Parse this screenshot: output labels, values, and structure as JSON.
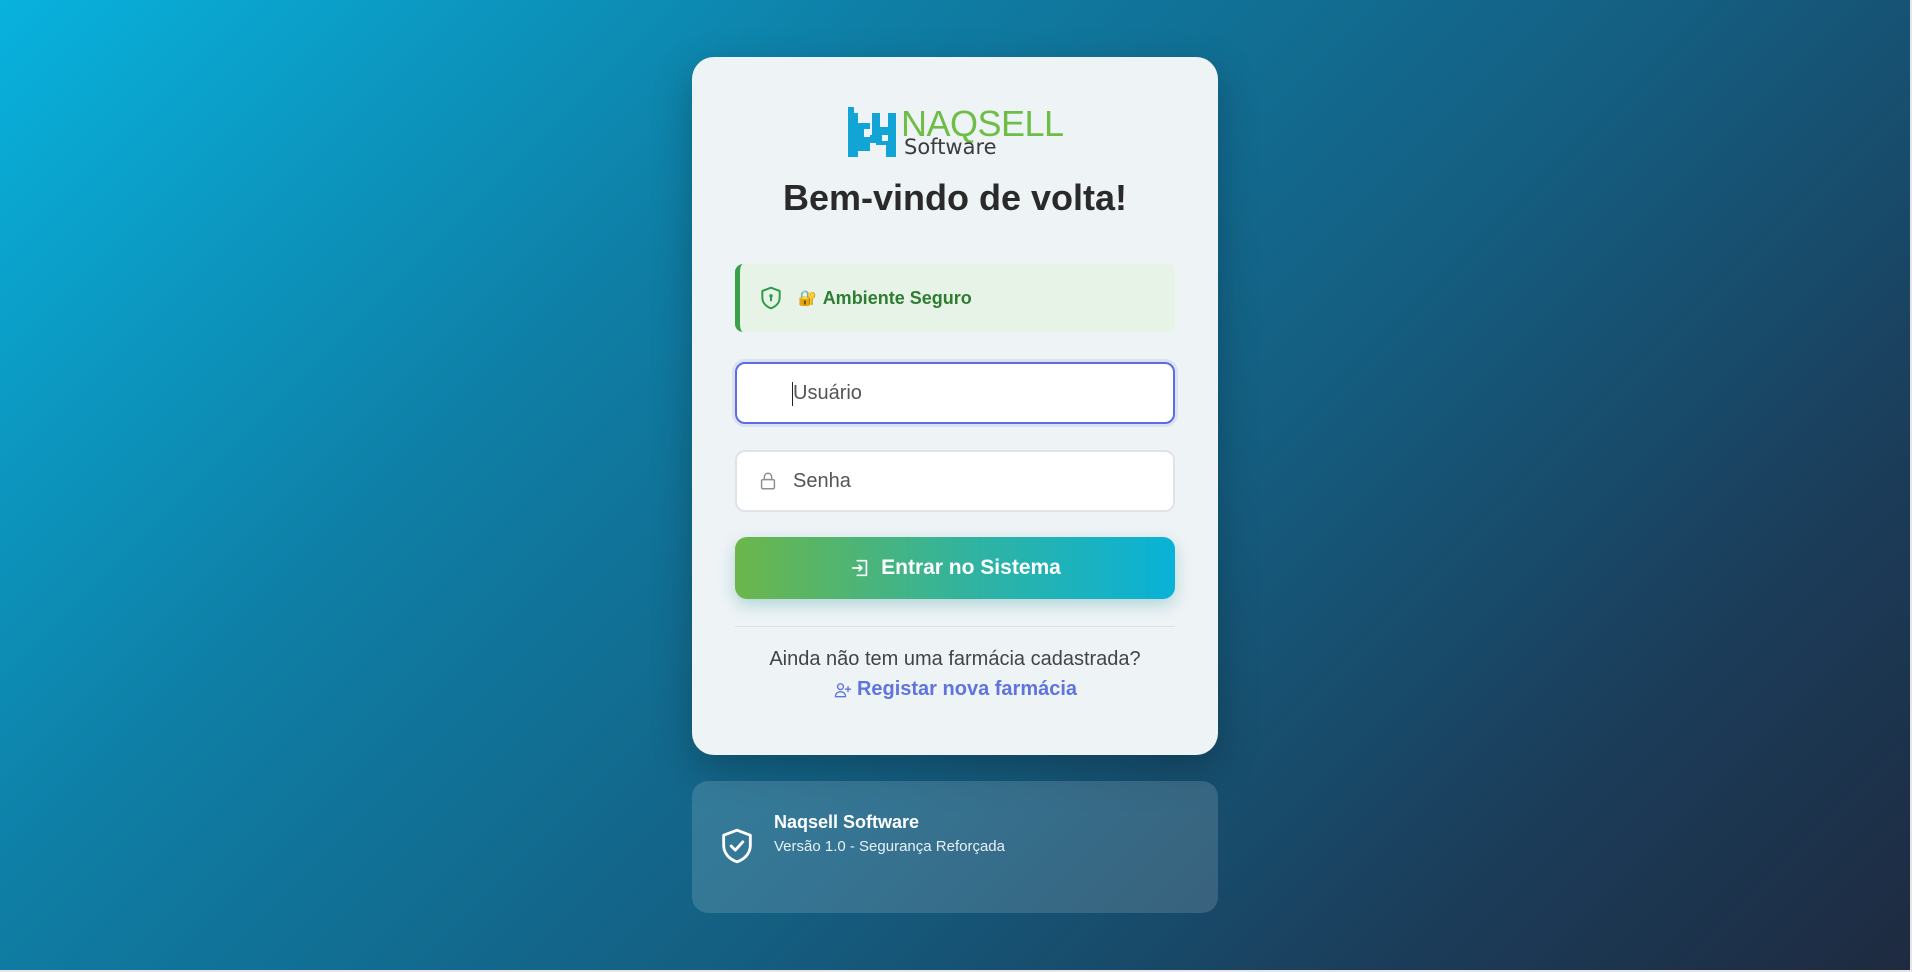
{
  "brand": {
    "name": "NAQSELL",
    "sub": "Software",
    "colors": {
      "primary_green": "#6dbd46",
      "primary_blue": "#12a4d4"
    }
  },
  "login": {
    "title": "Bem-vindo de volta!",
    "secure_banner": {
      "emoji": "🔐",
      "text": "Ambiente Seguro",
      "icon": "shield-alert-icon"
    },
    "username": {
      "placeholder": "Usuário",
      "value": ""
    },
    "password": {
      "placeholder": "Senha",
      "value": "",
      "icon": "lock-icon"
    },
    "submit_label": "Entrar no Sistema",
    "submit_icon": "login-icon",
    "register_question": "Ainda não tem uma farmácia cadastrada?",
    "register_link": "Registar nova farmácia",
    "register_icon": "user-plus-icon"
  },
  "footer": {
    "company": "Naqsell Software",
    "version": "Versão 1.0 - Segurança Reforçada",
    "icon": "shield-check-icon"
  }
}
